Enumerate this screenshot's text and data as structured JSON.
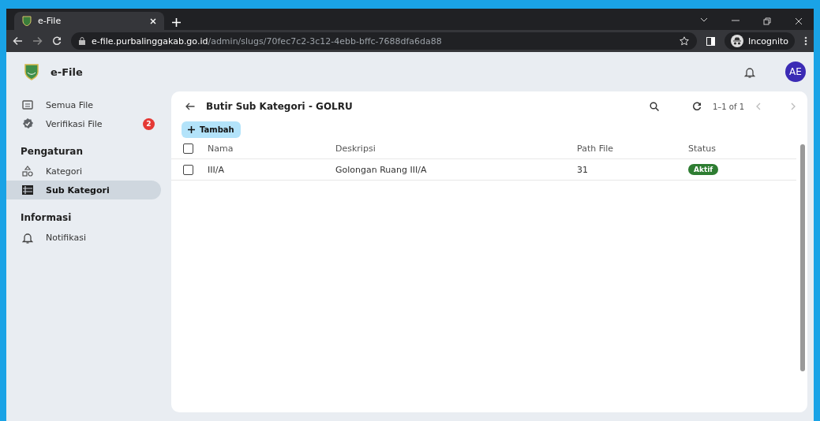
{
  "browser": {
    "tab_title": "e-File",
    "url_host": "e-file.purbalinggakab.go.id",
    "url_path": "/admin/slugs/70fec7c2-3c12-4ebb-bffc-7688dfa6da88",
    "profile": "Incognito"
  },
  "app": {
    "title": "e-File",
    "avatar": "AE"
  },
  "sidebar": {
    "sections": [
      {
        "items": [
          {
            "label": "Semua File",
            "selected": false
          },
          {
            "label": "Verifikasi File",
            "badge": "2",
            "selected": false
          }
        ]
      },
      {
        "heading": "Pengaturan",
        "items": [
          {
            "label": "Kategori",
            "selected": false
          },
          {
            "label": "Sub Kategori",
            "selected": true
          }
        ]
      },
      {
        "heading": "Informasi",
        "items": [
          {
            "label": "Notifikasi",
            "selected": false
          }
        ]
      }
    ]
  },
  "card": {
    "title": "Butir Sub Kategori - GOLRU",
    "add_button": "Tambah",
    "pagination": "1–1 of 1",
    "table": {
      "all_checked": false,
      "columns": [
        "Nama",
        "Deskripsi",
        "Path File",
        "Status"
      ],
      "rows": [
        {
          "checked": false,
          "cells": [
            "III/A",
            "Golongan Ruang III/A",
            "31"
          ],
          "status": {
            "label": "Aktif",
            "active": true
          }
        }
      ]
    }
  }
}
